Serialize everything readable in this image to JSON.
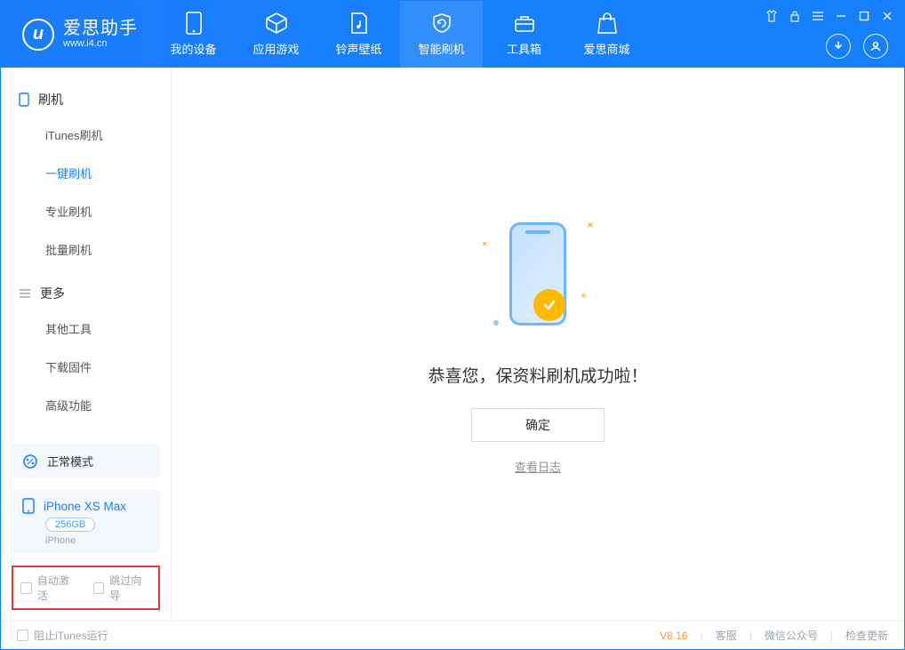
{
  "app": {
    "name_cn": "爱思助手",
    "name_en": "www.i4.cn"
  },
  "tabs": [
    {
      "label": "我的设备"
    },
    {
      "label": "应用游戏"
    },
    {
      "label": "铃声壁纸"
    },
    {
      "label": "智能刷机"
    },
    {
      "label": "工具箱"
    },
    {
      "label": "爱思商城"
    }
  ],
  "sidebar": {
    "group1_title": "刷机",
    "group1": [
      {
        "label": "iTunes刷机"
      },
      {
        "label": "一键刷机"
      },
      {
        "label": "专业刷机"
      },
      {
        "label": "批量刷机"
      }
    ],
    "group2_title": "更多",
    "group2": [
      {
        "label": "其他工具"
      },
      {
        "label": "下载固件"
      },
      {
        "label": "高级功能"
      }
    ]
  },
  "mode": {
    "label": "正常模式"
  },
  "device": {
    "name": "iPhone XS Max",
    "storage": "256GB",
    "type": "iPhone"
  },
  "options": {
    "auto_activate": "自动激活",
    "skip_guide": "跳过向导"
  },
  "main": {
    "success_text": "恭喜您，保资料刷机成功啦！",
    "ok_label": "确定",
    "log_label": "查看日志"
  },
  "footer": {
    "block_itunes": "阻止iTunes运行",
    "version": "V8.16",
    "links": [
      "客服",
      "微信公众号",
      "检查更新"
    ]
  }
}
